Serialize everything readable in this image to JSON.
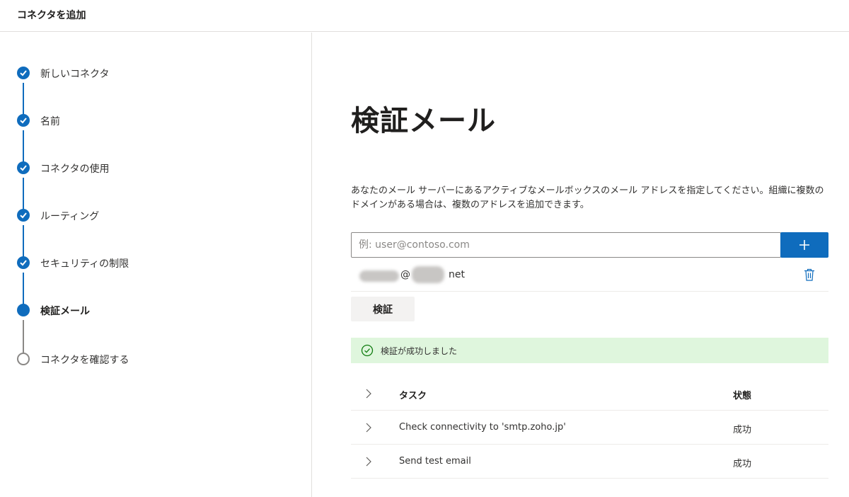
{
  "header": {
    "title": "コネクタを追加"
  },
  "steps": [
    {
      "label": "新しいコネクタ",
      "state": "done"
    },
    {
      "label": "名前",
      "state": "done"
    },
    {
      "label": "コネクタの使用",
      "state": "done"
    },
    {
      "label": "ルーティング",
      "state": "done"
    },
    {
      "label": "セキュリティの制限",
      "state": "done"
    },
    {
      "label": "検証メール",
      "state": "current"
    },
    {
      "label": "コネクタを確認する",
      "state": "pending"
    }
  ],
  "main": {
    "title": "検証メール",
    "description": "あなたのメール サーバーにあるアクティブなメールボックスのメール アドレスを指定してください。組織に複数のドメインがある場合は、複数のアドレスを追加できます。",
    "email_input": {
      "placeholder": "例: user@contoso.com",
      "value": ""
    },
    "email_entry": {
      "at_sign": "@",
      "suffix": "net"
    },
    "verify_button": "検証",
    "success_message": "検証が成功しました",
    "table": {
      "headers": {
        "task": "タスク",
        "status": "状態"
      },
      "rows": [
        {
          "task": "Check connectivity to 'smtp.zoho.jp'",
          "status": "成功"
        },
        {
          "task": "Send test email",
          "status": "成功"
        }
      ]
    }
  },
  "colors": {
    "accent": "#0f6cbd",
    "success_bg": "#dff6dd",
    "success_icon": "#107c10"
  }
}
